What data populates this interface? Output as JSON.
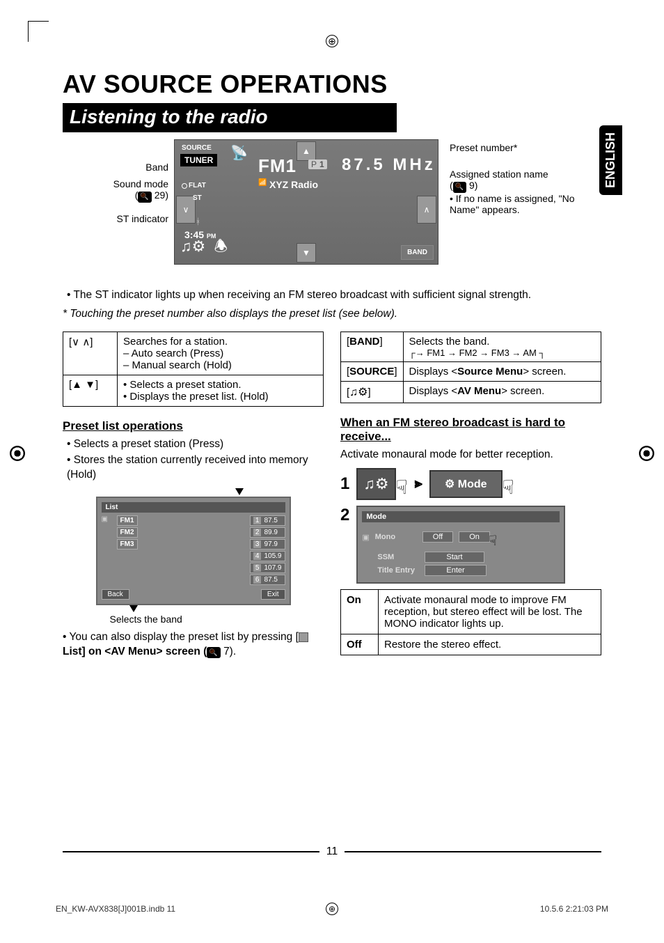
{
  "side_tab": "ENGLISH",
  "main_title": "AV SOURCE OPERATIONS",
  "section_title": "Listening to the radio",
  "screen": {
    "source_label": "SOURCE",
    "tuner_label": "TUNER",
    "band": "FM1",
    "preset_p": "P",
    "preset_num": "1",
    "frequency": "87.5 MHz",
    "station": "XYZ Radio",
    "flat": "FLAT",
    "st": "ST",
    "clock": "3:45",
    "ampm": "PM",
    "band_btn": "BAND"
  },
  "callouts": {
    "band": "Band",
    "sound_mode": "Sound mode",
    "sound_mode_ref": "29)",
    "st_indicator": "ST indicator",
    "preset_number": "Preset number*",
    "assigned_name": "Assigned station name",
    "assigned_ref": "9)",
    "no_name": "If no name is assigned, \"No Name\" appears."
  },
  "body_notes": {
    "st_note": "The ST indicator lights up when receiving an FM stereo broadcast with sufficient signal strength.",
    "ast_note": "Touching the preset number also displays the preset list (see below)."
  },
  "left_table": {
    "r1_key": "[∨ ∧]",
    "r1_line1": "Searches for a station.",
    "r1_line2": "– Auto search (Press)",
    "r1_line3": "– Manual search (Hold)",
    "r2_key": "[▲ ▼]",
    "r2_line1": "Selects a preset station.",
    "r2_line2": "Displays the preset list. (Hold)"
  },
  "right_table": {
    "r1_key": "[BAND]",
    "r1_line1": "Selects the band.",
    "r1_cycle": "FM1 → FM2 → FM3 → AM",
    "r2_key": "[SOURCE]",
    "r2_val": "Displays <Source Menu> screen.",
    "r3_key_icons": "♫⚙",
    "r3_val": "Displays <AV Menu> screen."
  },
  "preset_section": {
    "heading": "Preset list operations",
    "b1": "Selects a preset station (Press)",
    "b2": "Stores the station currently received into memory (Hold)",
    "list_label": "List",
    "bands": [
      "FM1",
      "FM2",
      "FM3"
    ],
    "presets": [
      {
        "n": "1",
        "f": "87.5"
      },
      {
        "n": "2",
        "f": "89.9"
      },
      {
        "n": "3",
        "f": "97.9"
      },
      {
        "n": "4",
        "f": "105.9"
      },
      {
        "n": "5",
        "f": "107.9"
      },
      {
        "n": "6",
        "f": "87.5"
      }
    ],
    "back": "Back",
    "exit": "Exit",
    "selects_band": "Selects the band",
    "also_text_1": "You can also display the preset list by pressing [",
    "also_text_2": " List] on <AV Menu> screen (",
    "also_ref": "7)."
  },
  "fm_section": {
    "heading": "When an FM stereo broadcast is hard to receive...",
    "activate": "Activate monaural mode for better reception.",
    "mode_label": "Mode",
    "panel": {
      "title": "Mode",
      "mono": "Mono",
      "off": "Off",
      "on": "On",
      "ssm": "SSM",
      "start": "Start",
      "title_entry": "Title Entry",
      "enter": "Enter"
    },
    "on_off": {
      "on_key": "On",
      "on_val": "Activate monaural mode to improve FM reception, but stereo effect will be lost. The MONO indicator lights up.",
      "off_key": "Off",
      "off_val": "Restore the stereo effect."
    }
  },
  "page_number": "11",
  "footer_left": "EN_KW-AVX838[J]001B.indb   11",
  "footer_right": "10.5.6   2:21:03 PM"
}
